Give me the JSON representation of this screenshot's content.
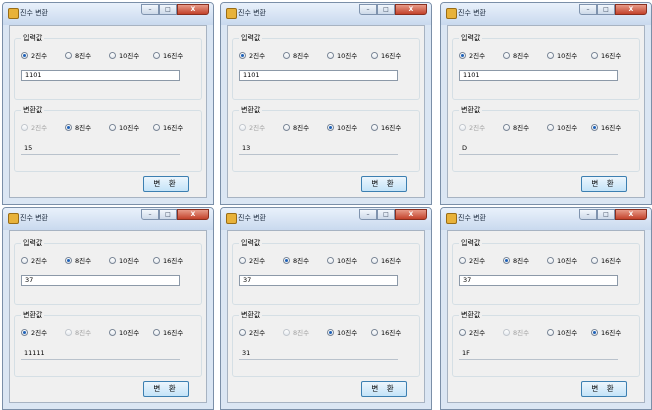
{
  "labels": {
    "title": "진수 변환",
    "input_group": "입력값",
    "output_group": "변환값",
    "radix": [
      "2진수",
      "8진수",
      "10진수",
      "16진수"
    ],
    "button": "변 환",
    "close": "X"
  },
  "windows": [
    {
      "input_selected": 0,
      "input_value": "1101",
      "output_selected": 1,
      "output_disabled": 0,
      "output_value": "15"
    },
    {
      "input_selected": 0,
      "input_value": "1101",
      "output_selected": 2,
      "output_disabled": 0,
      "output_value": "13"
    },
    {
      "input_selected": 0,
      "input_value": "1101",
      "output_selected": 3,
      "output_disabled": 0,
      "output_value": "D"
    },
    {
      "input_selected": 1,
      "input_value": "37",
      "output_selected": 0,
      "output_disabled": 1,
      "output_value": "11111"
    },
    {
      "input_selected": 1,
      "input_value": "37",
      "output_selected": 2,
      "output_disabled": 1,
      "output_value": "31"
    },
    {
      "input_selected": 1,
      "input_value": "37",
      "output_selected": 3,
      "output_disabled": 1,
      "output_value": "1F"
    }
  ]
}
